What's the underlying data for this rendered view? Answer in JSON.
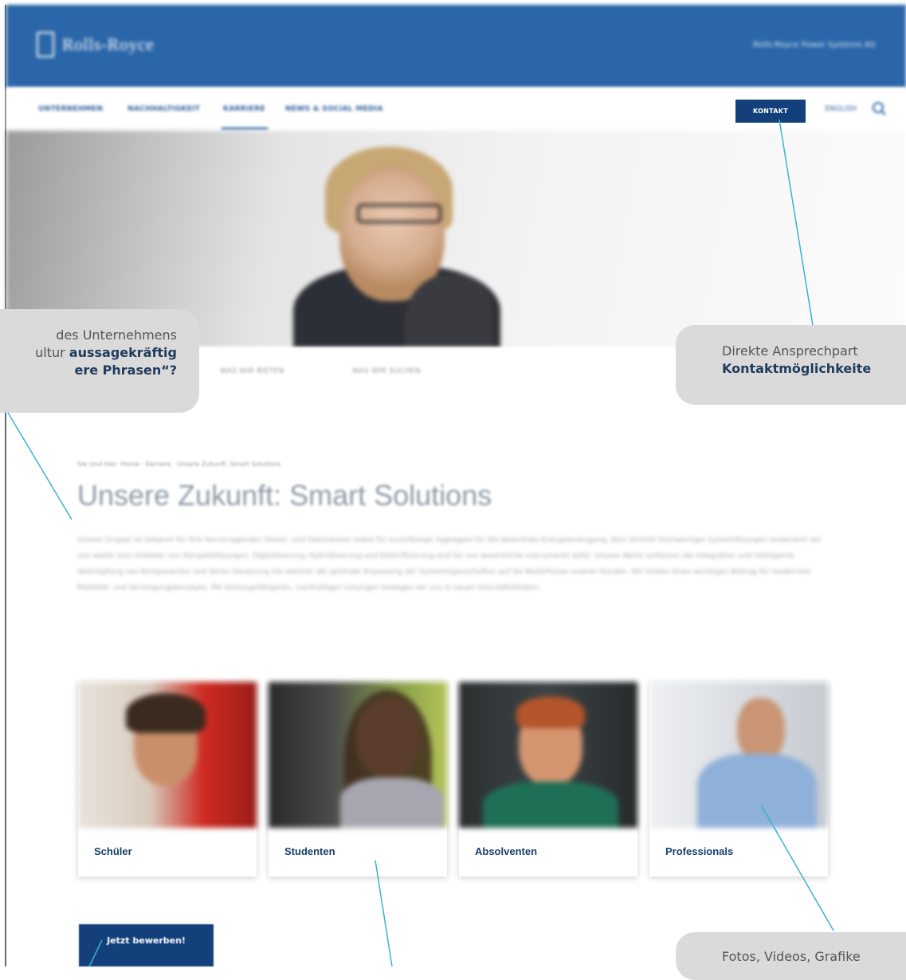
{
  "header": {
    "brand": "Rolls-Royce",
    "company": "Rolls-Royce Power Systems AG"
  },
  "nav": {
    "items": [
      "UNTERNEHMEN",
      "NACHHALTIGKEIT",
      "KARRIERE",
      "NEWS & SOCIAL MEDIA"
    ],
    "active_index": 2,
    "contact_button": "KONTAKT",
    "language": "ENGLISH"
  },
  "subnav": {
    "items": [
      "WAS WIR BIETEN",
      "WAS WIR SUCHEN"
    ]
  },
  "breadcrumb": "Sie sind hier: Home · Karriere · Unsere Zukunft: Smart Solutions",
  "page": {
    "title": "Unsere Zukunft: Smart Solutions",
    "intro": "Unsere Gruppe ist bekannt für ihre hervorragenden Diesel- und Gasmotoren sowie für zuverlässige Aggregate für die dezentrale Energieerzeugung. Kein Vorteile hochwertiger Systemlösungen entwickeln wir uns weiter zum Anbieter von Komplettlösungen. Digitalisierung, Hybridisierung und Elektrifizierung sind für uns wesentliche Instrumente dafür. Unsere Werte umfassen die Integration und intelligente Verknüpfung von Komponenten und deren Steuerung mit welcher die optimale Anpassung der Systemeigenschaften auf die Bedürfnisse unserer Kunden. Wir leisten einen wichtigen Beitrag für modernere Mobilität- und Versorgungskonzepte. Mit leistungsfähigeren, nachhaltigen Lösungen bewegen wir uns in neuen Geschäftsfeldern."
  },
  "cards": [
    {
      "label": "Schüler"
    },
    {
      "label": "Studenten"
    },
    {
      "label": "Absolventen"
    },
    {
      "label": "Professionals"
    }
  ],
  "apply_button": "Jetzt bewerben!",
  "callouts": {
    "left_line1": "des Unternehmens",
    "left_line2_pre": "ultur ",
    "left_line2_bold": "aussagekräftig",
    "left_line3_bold": "ere Phrasen“?",
    "right_line1": "Direkte Ansprechpart",
    "right_line2_bold": "Kontaktmöglichkeite",
    "bottom_line1": "Fotos, Videos, Grafike"
  },
  "colors": {
    "header_blue": "#2a66a8",
    "button_navy": "#13407a",
    "callout_gray": "#dadada",
    "connector_cyan": "#3bb3d0"
  }
}
